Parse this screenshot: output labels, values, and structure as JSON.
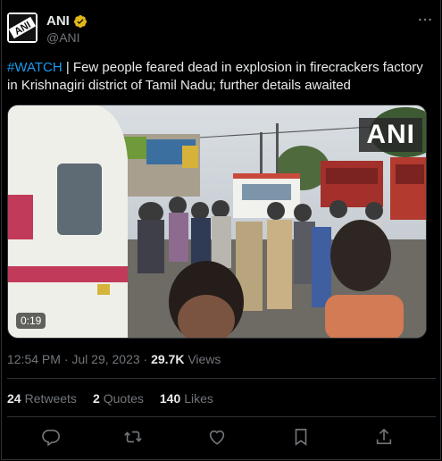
{
  "author": {
    "name": "ANI",
    "handle": "@ANI",
    "avatar_text": "ANI"
  },
  "tweet": {
    "hashtag": "#WATCH",
    "text": " | Few people feared dead in explosion in firecrackers factory in Krishnagiri district of Tamil Nadu; further details awaited"
  },
  "media": {
    "watermark": "ANI",
    "duration": "0:19"
  },
  "meta": {
    "timestamp": "12:54 PM · Jul 29, 2023 · ",
    "views_count": "29.7K",
    "views_label": " Views"
  },
  "stats": {
    "retweets_count": "24",
    "retweets_label": "Retweets",
    "quotes_count": "2",
    "quotes_label": "Quotes",
    "likes_count": "140",
    "likes_label": "Likes"
  },
  "icons": {
    "more": "more-icon",
    "reply": "reply-icon",
    "retweet": "retweet-icon",
    "like": "like-icon",
    "bookmark": "bookmark-icon",
    "share": "share-icon",
    "verified": "verified-badge-icon"
  },
  "colors": {
    "background": "#000000",
    "text": "#e7e9ea",
    "secondary": "#71767b",
    "accent": "#1d9bf0",
    "verified_gold": "#e2b719",
    "border": "#2f3336"
  }
}
